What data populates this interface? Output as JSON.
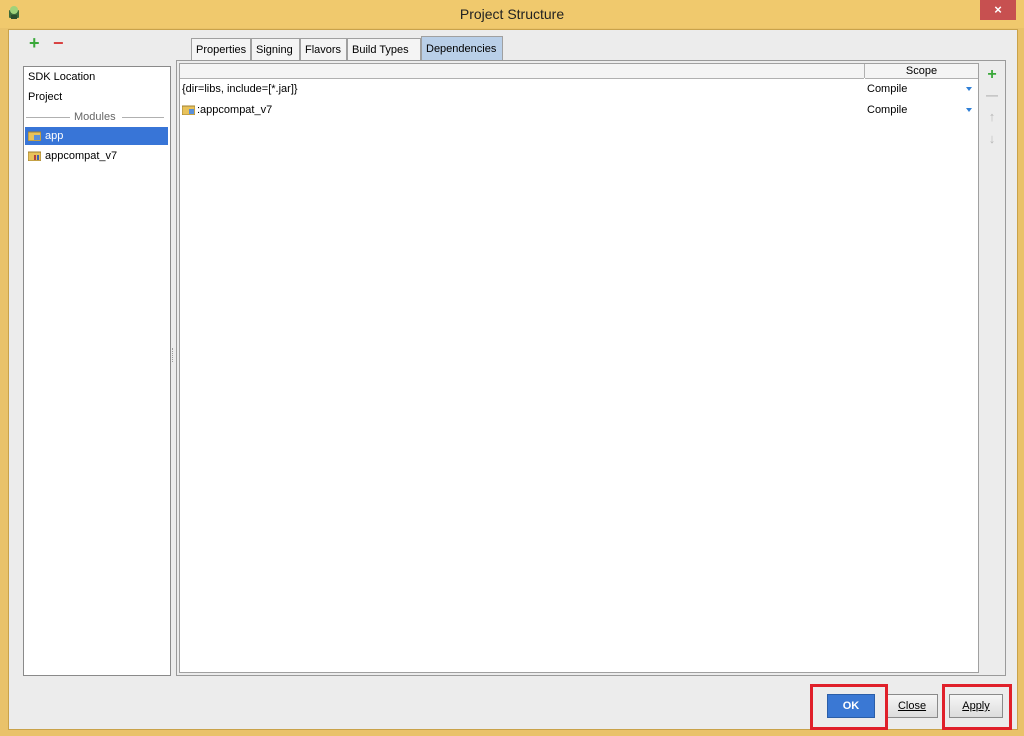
{
  "window": {
    "title": "Project Structure",
    "close_glyph": "×"
  },
  "left_toolbar": {
    "add_glyph": "+",
    "remove_glyph": "−"
  },
  "nav": {
    "items": [
      {
        "label": "SDK Location"
      },
      {
        "label": "Project"
      }
    ],
    "modules_header": "Modules",
    "modules": [
      {
        "label": "app",
        "selected": true
      },
      {
        "label": "appcompat_v7",
        "selected": false
      }
    ]
  },
  "tabs": [
    {
      "label": "Properties",
      "active": false
    },
    {
      "label": "Signing",
      "active": false
    },
    {
      "label": "Flavors",
      "active": false
    },
    {
      "label": "Build Types",
      "active": false
    },
    {
      "label": "Dependencies",
      "active": true
    }
  ],
  "table": {
    "columns": [
      "",
      "Scope"
    ],
    "rows": [
      {
        "name": "{dir=libs, include=[*.jar]}",
        "scope": "Compile",
        "icon": null
      },
      {
        "name": ":appcompat_v7",
        "scope": "Compile",
        "icon": "module-folder-icon"
      }
    ]
  },
  "side_toolbar": {
    "add_glyph": "+",
    "remove_glyph": "—",
    "up_glyph": "↑",
    "down_glyph": "↓"
  },
  "footer": {
    "ok_label": "OK",
    "close_label": "Close",
    "apply_label": "Apply"
  },
  "colors": {
    "title_bar": "#f0c96d",
    "selection": "#3875d7",
    "primary_button": "#3a78d4",
    "highlight_box": "#e0202a"
  }
}
